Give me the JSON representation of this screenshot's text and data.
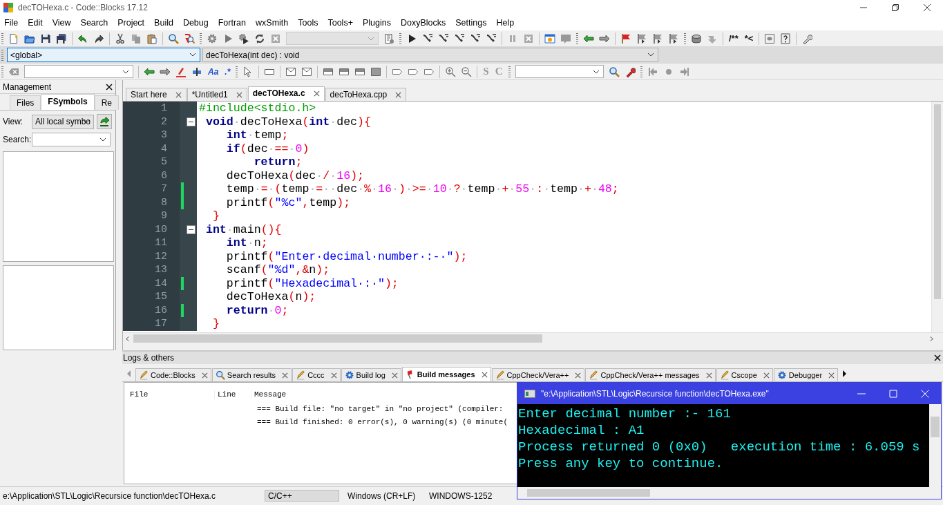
{
  "window": {
    "title": "decTOHexa.c - Code::Blocks 17.12"
  },
  "menu": [
    "File",
    "Edit",
    "View",
    "Search",
    "Project",
    "Build",
    "Debug",
    "Fortran",
    "wxSmith",
    "Tools",
    "Tools+",
    "Plugins",
    "DoxyBlocks",
    "Settings",
    "Help"
  ],
  "toolbar_labels": {
    "comment": [
      "/**",
      "*<"
    ],
    "search": [
      "Aa",
      ".*"
    ],
    "style": [
      "S",
      "C"
    ]
  },
  "code_navigation": {
    "scope": "<global>",
    "function": "decToHexa(int dec) : void"
  },
  "management": {
    "title": "Management",
    "tabs": [
      {
        "label": "Files",
        "selected": false
      },
      {
        "label": "FSymbols",
        "selected": true
      },
      {
        "label": "Re",
        "selected": false
      }
    ],
    "view_label": "View:",
    "view_value": "All local symbo",
    "search_label": "Search:"
  },
  "editor_tabs": [
    {
      "label": "Start here",
      "selected": false
    },
    {
      "label": "*Untitled1",
      "selected": false
    },
    {
      "label": "decTOHexa.c",
      "selected": true
    },
    {
      "label": "decToHexa.cpp",
      "selected": false
    }
  ],
  "lines": [
    {
      "number": "1",
      "changed": false,
      "foldable": false,
      "tokens": [
        {
          "kind": "pre",
          "text": "#include<stdio.h>"
        }
      ]
    },
    {
      "number": "2",
      "changed": false,
      "foldable": true,
      "tokens": [
        {
          "kind": "kw",
          "text": " void"
        },
        {
          "kind": "ws",
          "text": "·"
        },
        {
          "kind": "id",
          "text": "decToHexa"
        },
        {
          "kind": "op",
          "text": "("
        },
        {
          "kind": "kw",
          "text": "int"
        },
        {
          "kind": "ws",
          "text": "·"
        },
        {
          "kind": "id",
          "text": "dec"
        },
        {
          "kind": "op",
          "text": "){"
        }
      ]
    },
    {
      "number": "3",
      "changed": false,
      "foldable": false,
      "tokens": [
        {
          "kind": "kw",
          "text": "    int"
        },
        {
          "kind": "ws",
          "text": "·"
        },
        {
          "kind": "id",
          "text": "temp"
        },
        {
          "kind": "op",
          "text": ";"
        }
      ]
    },
    {
      "number": "4",
      "changed": false,
      "foldable": false,
      "tokens": [
        {
          "kind": "kw",
          "text": "    if"
        },
        {
          "kind": "op",
          "text": "("
        },
        {
          "kind": "id",
          "text": "dec"
        },
        {
          "kind": "ws",
          "text": "·"
        },
        {
          "kind": "op",
          "text": "=="
        },
        {
          "kind": "ws",
          "text": "·"
        },
        {
          "kind": "num",
          "text": "0"
        },
        {
          "kind": "op",
          "text": ")"
        }
      ]
    },
    {
      "number": "5",
      "changed": false,
      "foldable": false,
      "tokens": [
        {
          "kind": "kw",
          "text": "        return"
        },
        {
          "kind": "op",
          "text": ";"
        }
      ]
    },
    {
      "number": "6",
      "changed": false,
      "foldable": false,
      "tokens": [
        {
          "kind": "id",
          "text": "    decToHexa"
        },
        {
          "kind": "op",
          "text": "("
        },
        {
          "kind": "id",
          "text": "dec"
        },
        {
          "kind": "ws",
          "text": "·"
        },
        {
          "kind": "op",
          "text": "/"
        },
        {
          "kind": "ws",
          "text": "·"
        },
        {
          "kind": "num",
          "text": "16"
        },
        {
          "kind": "op",
          "text": ");"
        }
      ]
    },
    {
      "number": "7",
      "changed": true,
      "foldable": false,
      "tokens": [
        {
          "kind": "id",
          "text": "    temp"
        },
        {
          "kind": "ws",
          "text": "·"
        },
        {
          "kind": "op",
          "text": "="
        },
        {
          "kind": "ws",
          "text": "·"
        },
        {
          "kind": "op",
          "text": "("
        },
        {
          "kind": "id",
          "text": "temp"
        },
        {
          "kind": "ws",
          "text": "·"
        },
        {
          "kind": "op",
          "text": "="
        },
        {
          "kind": "ws",
          "text": "··"
        },
        {
          "kind": "id",
          "text": "dec"
        },
        {
          "kind": "ws",
          "text": "·"
        },
        {
          "kind": "op",
          "text": "%"
        },
        {
          "kind": "ws",
          "text": "·"
        },
        {
          "kind": "num",
          "text": "16"
        },
        {
          "kind": "ws",
          "text": "·"
        },
        {
          "kind": "op",
          "text": ")"
        },
        {
          "kind": "ws",
          "text": "·"
        },
        {
          "kind": "op",
          "text": ">="
        },
        {
          "kind": "ws",
          "text": "·"
        },
        {
          "kind": "num",
          "text": "10"
        },
        {
          "kind": "ws",
          "text": "·"
        },
        {
          "kind": "op",
          "text": "?"
        },
        {
          "kind": "ws",
          "text": "·"
        },
        {
          "kind": "id",
          "text": "temp"
        },
        {
          "kind": "ws",
          "text": "·"
        },
        {
          "kind": "op",
          "text": "+"
        },
        {
          "kind": "ws",
          "text": "·"
        },
        {
          "kind": "num",
          "text": "55"
        },
        {
          "kind": "ws",
          "text": "·"
        },
        {
          "kind": "op",
          "text": ":"
        },
        {
          "kind": "ws",
          "text": "·"
        },
        {
          "kind": "id",
          "text": "temp"
        },
        {
          "kind": "ws",
          "text": "·"
        },
        {
          "kind": "op",
          "text": "+"
        },
        {
          "kind": "ws",
          "text": "·"
        },
        {
          "kind": "num",
          "text": "48"
        },
        {
          "kind": "op",
          "text": ";"
        }
      ]
    },
    {
      "number": "8",
      "changed": true,
      "foldable": false,
      "tokens": [
        {
          "kind": "id",
          "text": "    printf"
        },
        {
          "kind": "op",
          "text": "("
        },
        {
          "kind": "str",
          "text": "\"%c\""
        },
        {
          "kind": "op",
          "text": ","
        },
        {
          "kind": "id",
          "text": "temp"
        },
        {
          "kind": "op",
          "text": ");"
        }
      ]
    },
    {
      "number": "9",
      "changed": false,
      "foldable": false,
      "tokens": [
        {
          "kind": "op",
          "text": "  }"
        }
      ]
    },
    {
      "number": "10",
      "changed": false,
      "foldable": true,
      "tokens": [
        {
          "kind": "kw",
          "text": " int"
        },
        {
          "kind": "ws",
          "text": "·"
        },
        {
          "kind": "id",
          "text": "main"
        },
        {
          "kind": "op",
          "text": "(){"
        }
      ]
    },
    {
      "number": "11",
      "changed": false,
      "foldable": false,
      "tokens": [
        {
          "kind": "kw",
          "text": "    int"
        },
        {
          "kind": "ws",
          "text": "·"
        },
        {
          "kind": "id",
          "text": "n"
        },
        {
          "kind": "op",
          "text": ";"
        }
      ]
    },
    {
      "number": "12",
      "changed": false,
      "foldable": false,
      "tokens": [
        {
          "kind": "id",
          "text": "    printf"
        },
        {
          "kind": "op",
          "text": "("
        },
        {
          "kind": "str",
          "text": "\"Enter·decimal·number·:-·\""
        },
        {
          "kind": "op",
          "text": ");"
        }
      ]
    },
    {
      "number": "13",
      "changed": false,
      "foldable": false,
      "tokens": [
        {
          "kind": "id",
          "text": "    scanf"
        },
        {
          "kind": "op",
          "text": "("
        },
        {
          "kind": "str",
          "text": "\"%d\""
        },
        {
          "kind": "op",
          "text": ",&"
        },
        {
          "kind": "id",
          "text": "n"
        },
        {
          "kind": "op",
          "text": ");"
        }
      ]
    },
    {
      "number": "14",
      "changed": true,
      "foldable": false,
      "tokens": [
        {
          "kind": "id",
          "text": "    printf"
        },
        {
          "kind": "op",
          "text": "("
        },
        {
          "kind": "str",
          "text": "\"Hexadecimal·:·\""
        },
        {
          "kind": "op",
          "text": ");"
        }
      ]
    },
    {
      "number": "15",
      "changed": false,
      "foldable": false,
      "tokens": [
        {
          "kind": "id",
          "text": "    decToHexa"
        },
        {
          "kind": "op",
          "text": "("
        },
        {
          "kind": "id",
          "text": "n"
        },
        {
          "kind": "op",
          "text": ");"
        }
      ]
    },
    {
      "number": "16",
      "changed": true,
      "foldable": false,
      "tokens": [
        {
          "kind": "kw",
          "text": "    return"
        },
        {
          "kind": "ws",
          "text": "·"
        },
        {
          "kind": "num",
          "text": "0"
        },
        {
          "kind": "op",
          "text": ";"
        }
      ]
    },
    {
      "number": "17",
      "changed": false,
      "foldable": false,
      "tokens": [
        {
          "kind": "op",
          "text": "  }"
        }
      ]
    }
  ],
  "logs": {
    "title": "Logs & others",
    "tabs": [
      {
        "label": "Code::Blocks",
        "selected": false,
        "kind": "pencil"
      },
      {
        "label": "Search results",
        "selected": false,
        "kind": "search"
      },
      {
        "label": "Cccc",
        "selected": false,
        "kind": "pencil"
      },
      {
        "label": "Build log",
        "selected": false,
        "kind": "gear"
      },
      {
        "label": "Build messages",
        "selected": true,
        "kind": "flag"
      },
      {
        "label": "CppCheck/Vera++",
        "selected": false,
        "kind": "pencil"
      },
      {
        "label": "CppCheck/Vera++ messages",
        "selected": false,
        "kind": "pencil"
      },
      {
        "label": "Cscope",
        "selected": false,
        "kind": "pencil"
      },
      {
        "label": "Debugger",
        "selected": false,
        "kind": "gear"
      }
    ],
    "columns": [
      "File",
      "Line",
      "Message"
    ],
    "rows": [
      {
        "message": "=== Build file: \"no target\" in \"no project\" (compiler:"
      },
      {
        "message": "=== Build finished: 0 error(s), 0 warning(s) (0 minute("
      }
    ]
  },
  "status_bar": [
    "e:\\Application\\STL\\Logic\\Recursice function\\decTOHexa.c",
    "C/C++",
    "Windows (CR+LF)",
    "WINDOWS-1252"
  ],
  "console": {
    "title": "\"e:\\Application\\STL\\Logic\\Recursice function\\decTOHexa.exe\"",
    "lines": [
      "Enter decimal number :- 161",
      "Hexadecimal : A1",
      "Process returned 0 (0x0)   execution time : 6.059 s",
      "Press any key to continue."
    ]
  }
}
